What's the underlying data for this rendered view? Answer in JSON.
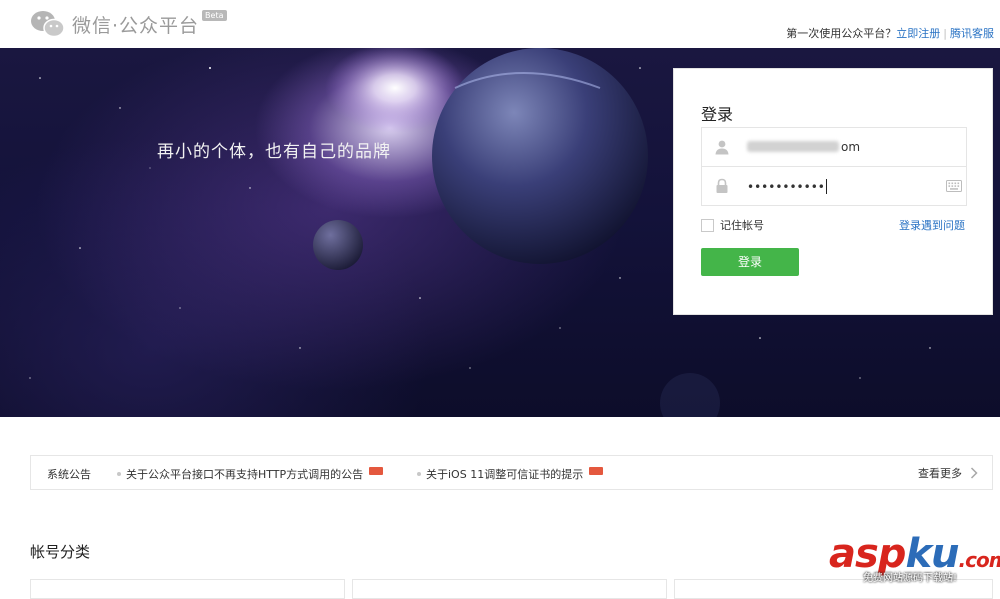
{
  "header": {
    "brand_title": "微信·公众平台",
    "beta_badge": "Beta",
    "first_time_text": "第一次使用公众平台？",
    "register_link": "立即注册",
    "divider": "|",
    "support_link": "腾讯客服"
  },
  "hero": {
    "slogan": "再小的个体，也有自己的品牌"
  },
  "login": {
    "title": "登录",
    "account_value_suffix": "om",
    "password_value": "•••••••••••",
    "remember_label": "记住帐号",
    "problem_link": "登录遇到问题",
    "submit_label": "登录"
  },
  "notice": {
    "label": "系统公告",
    "items": [
      {
        "text": "关于公众平台接口不再支持HTTP方式调用的公告"
      },
      {
        "text": "关于iOS 11调整可信证书的提示"
      }
    ],
    "more_label": "查看更多"
  },
  "accounts": {
    "section_title": "帐号分类"
  },
  "watermark": {
    "brand_left": "asp",
    "brand_right": "ku",
    "suffix": ".com",
    "tagline": "免费网站源码下载站!"
  },
  "colors": {
    "primary_green": "#44b549",
    "link_blue": "#2a73c4",
    "hero_dark": "#13123a",
    "new_badge_red": "#e4583e"
  }
}
